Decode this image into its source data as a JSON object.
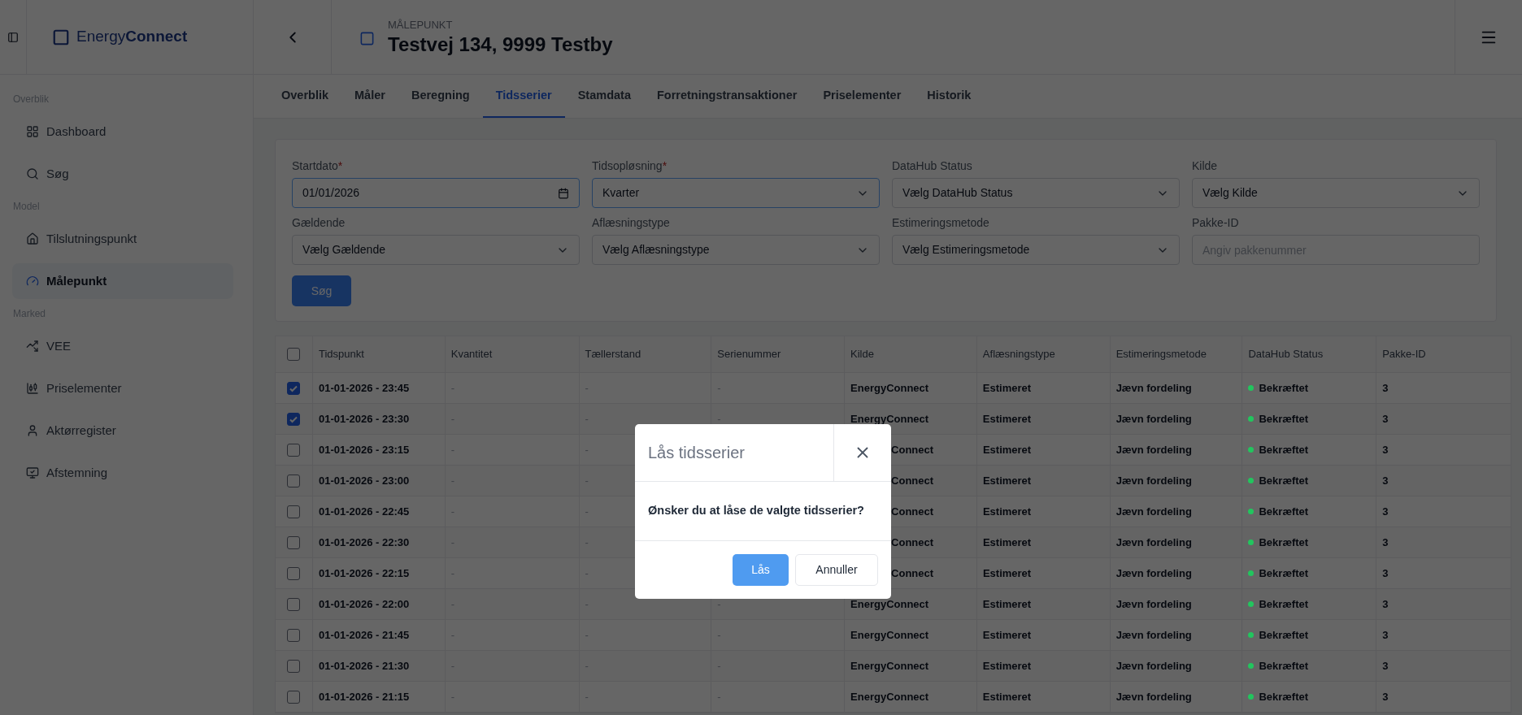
{
  "logo": "Energy**Connect**",
  "header": {
    "overline": "MÅLEPUNKT",
    "title": "Testvej 134, 9999 Testby"
  },
  "sidebar": {
    "sections": [
      {
        "label": "Overblik",
        "items": [
          {
            "label": "Dashboard",
            "selected": false
          },
          {
            "label": "Søg",
            "selected": false
          }
        ]
      },
      {
        "label": "Model",
        "items": [
          {
            "label": "Tilslutningspunkt",
            "selected": false
          },
          {
            "label": "Målepunkt",
            "selected": true
          }
        ]
      },
      {
        "label": "Marked",
        "items": [
          {
            "label": "VEE",
            "selected": false
          },
          {
            "label": "Priselementer",
            "selected": false
          },
          {
            "label": "Aktørregister",
            "selected": false
          },
          {
            "label": "Afstemning",
            "selected": false
          }
        ]
      }
    ]
  },
  "tabs": [
    {
      "label": "Overblik",
      "selected": false
    },
    {
      "label": "Måler",
      "selected": false
    },
    {
      "label": "Beregning",
      "selected": false
    },
    {
      "label": "Tidsserier",
      "selected": true
    },
    {
      "label": "Stamdata",
      "selected": false
    },
    {
      "label": "Forretningstransaktioner",
      "selected": false
    },
    {
      "label": "Priselementer",
      "selected": false
    },
    {
      "label": "Historik",
      "selected": false
    }
  ],
  "filters": [
    {
      "label": "Startdato",
      "required_mark": "*",
      "kind": "date",
      "value": "01/01/2026"
    },
    {
      "label": "Tidsopløsning",
      "required_mark": "*",
      "kind": "select",
      "value": "Kvarter"
    },
    {
      "label": "DataHub Status",
      "kind": "select",
      "value": "Vælg DataHub Status"
    },
    {
      "label": "Kilde",
      "kind": "select",
      "value": "Vælg Kilde"
    },
    {
      "label": "Gældende",
      "kind": "select",
      "value": "Vælg Gældende"
    },
    {
      "label": "Aflæsningstype",
      "kind": "select",
      "value": "Vælg Aflæsningstype"
    },
    {
      "label": "Estimeringsmetode",
      "kind": "select",
      "value": "Vælg Estimeringsmetode"
    },
    {
      "label": "Pakke-ID",
      "kind": "text",
      "placeholder": "Angiv pakkenummer"
    }
  ],
  "search_button": "Søg",
  "table": {
    "all_checked": false,
    "columns": [
      "Tidspunkt",
      "Kvantitet",
      "Tællerstand",
      "Serienummer",
      "Kilde",
      "Aflæsningstype",
      "Estimeringsmetode",
      "DataHub Status",
      "Pakke-ID"
    ],
    "rows": [
      {
        "checked": true,
        "tidspunkt": "01-01-2026 - 23:45",
        "kvantitet": "-",
        "taellerstand": "-",
        "serienummer": "-",
        "kilde": "EnergyConnect",
        "aflaesningstype": "Estimeret",
        "estimeringsmetode": "Jævn fordeling",
        "status": "Bekræftet",
        "color": "#22c55e",
        "pakke_id": "3"
      },
      {
        "checked": true,
        "tidspunkt": "01-01-2026 - 23:30",
        "kvantitet": "-",
        "taellerstand": "-",
        "serienummer": "-",
        "kilde": "EnergyConnect",
        "aflaesningstype": "Estimeret",
        "estimeringsmetode": "Jævn fordeling",
        "status": "Bekræftet",
        "color": "#22c55e",
        "pakke_id": "3"
      },
      {
        "checked": false,
        "tidspunkt": "01-01-2026 - 23:15",
        "kvantitet": "-",
        "taellerstand": "-",
        "kilde_visible_part": "Connect",
        "aflaesningstype": "Estimeret",
        "estimeringsmetode": "Jævn fordeling",
        "status": "Bekræftet",
        "color": "#22c55e",
        "pakke_id": "3"
      },
      {
        "checked": false,
        "tidspunkt": "01-01-2026 - 23:00",
        "kvantitet": "-",
        "taellerstand": "-",
        "kilde_visible_part": "Connect",
        "aflaesningstype": "Estimeret",
        "estimeringsmetode": "Jævn fordeling",
        "status": "Bekræftet",
        "color": "#22c55e",
        "pakke_id": "3"
      },
      {
        "checked": false,
        "tidspunkt": "01-01-2026 - 22:45",
        "kvantitet": "-",
        "taellerstand": "-",
        "kilde_visible_part": "Connect",
        "aflaesningstype": "Estimeret",
        "estimeringsmetode": "Jævn fordeling",
        "status": "Bekræftet",
        "color": "#22c55e",
        "pakke_id": "3"
      },
      {
        "checked": false,
        "tidspunkt": "01-01-2026 - 22:30",
        "kvantitet": "-",
        "taellerstand": "-",
        "kilde_visible_part": "Connect",
        "aflaesningstype": "Estimeret",
        "estimeringsmetode": "Jævn fordeling",
        "status": "Bekræftet",
        "color": "#22c55e",
        "pakke_id": "3"
      },
      {
        "checked": false,
        "tidspunkt": "01-01-2026 - 22:15",
        "kvantitet": "-",
        "taellerstand": "-",
        "kilde_visible_part": "Connect",
        "aflaesningstype": "Estimeret",
        "estimeringsmetode": "Jævn fordeling",
        "status": "Bekræftet",
        "color": "#22c55e",
        "pakke_id": "3"
      },
      {
        "checked": false,
        "tidspunkt": "01-01-2026 - 22:00",
        "kvantitet": "-",
        "taellerstand": "-",
        "serienummer": "-",
        "kilde": "EnergyConnect",
        "aflaesningstype": "Estimeret",
        "estimeringsmetode": "Jævn fordeling",
        "status": "Bekræftet",
        "color": "#22c55e",
        "pakke_id": "3"
      },
      {
        "checked": false,
        "tidspunkt": "01-01-2026 - 21:45",
        "kvantitet": "-",
        "taellerstand": "-",
        "serienummer": "-",
        "kilde": "EnergyConnect",
        "aflaesningstype": "Estimeret",
        "estimeringsmetode": "Jævn fordeling",
        "status": "Bekræftet",
        "color": "#22c55e",
        "pakke_id": "3"
      },
      {
        "checked": false,
        "tidspunkt": "01-01-2026 - 21:30",
        "kvantitet": "-",
        "taellerstand": "-",
        "serienummer": "-",
        "kilde": "EnergyConnect",
        "aflaesningstype": "Estimeret",
        "estimeringsmetode": "Jævn fordeling",
        "status": "Bekræftet",
        "color": "#22c55e",
        "pakke_id": "3"
      },
      {
        "checked": false,
        "tidspunkt": "01-01-2026 - 21:15",
        "kvantitet": "-",
        "taellerstand": "-",
        "serienummer": "-",
        "kilde": "EnergyConnect",
        "aflaesningstype": "Estimeret",
        "estimeringsmetode": "Jævn fordeling",
        "status": "Bekræftet",
        "color": "#22c55e",
        "pakke_id": "3"
      }
    ]
  },
  "dialog": {
    "title": "Lås tidsserier",
    "message": "Ønsker du at låse de valgte tidsserier?",
    "buttons": [
      {
        "label": "Lås",
        "kind": "primary"
      },
      {
        "label": "Annuller",
        "kind": "secondary"
      }
    ]
  }
}
